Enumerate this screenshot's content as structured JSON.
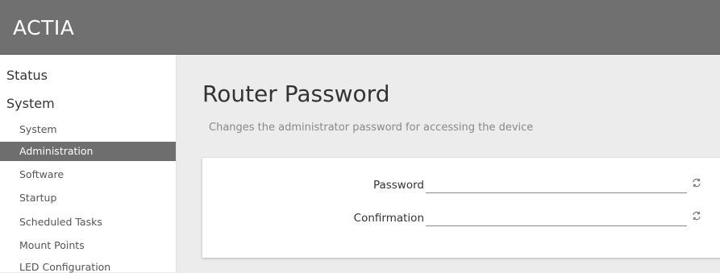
{
  "header": {
    "brand": "ACTIA"
  },
  "sidebar": {
    "sections": [
      {
        "label": "Status"
      },
      {
        "label": "System"
      }
    ],
    "items": [
      {
        "label": "System"
      },
      {
        "label": "Administration",
        "active": true
      },
      {
        "label": "Software"
      },
      {
        "label": "Startup"
      },
      {
        "label": "Scheduled Tasks"
      },
      {
        "label": "Mount Points"
      },
      {
        "label": "LED Configuration"
      }
    ]
  },
  "page": {
    "title": "Router Password",
    "description": "Changes the administrator password for accessing the device"
  },
  "form": {
    "password": {
      "label": "Password",
      "value": ""
    },
    "confirmation": {
      "label": "Confirmation",
      "value": ""
    },
    "reveal_icon": "reveal-password-icon"
  },
  "colors": {
    "header_bg": "#707070",
    "active_item_bg": "#6e6e6e"
  }
}
